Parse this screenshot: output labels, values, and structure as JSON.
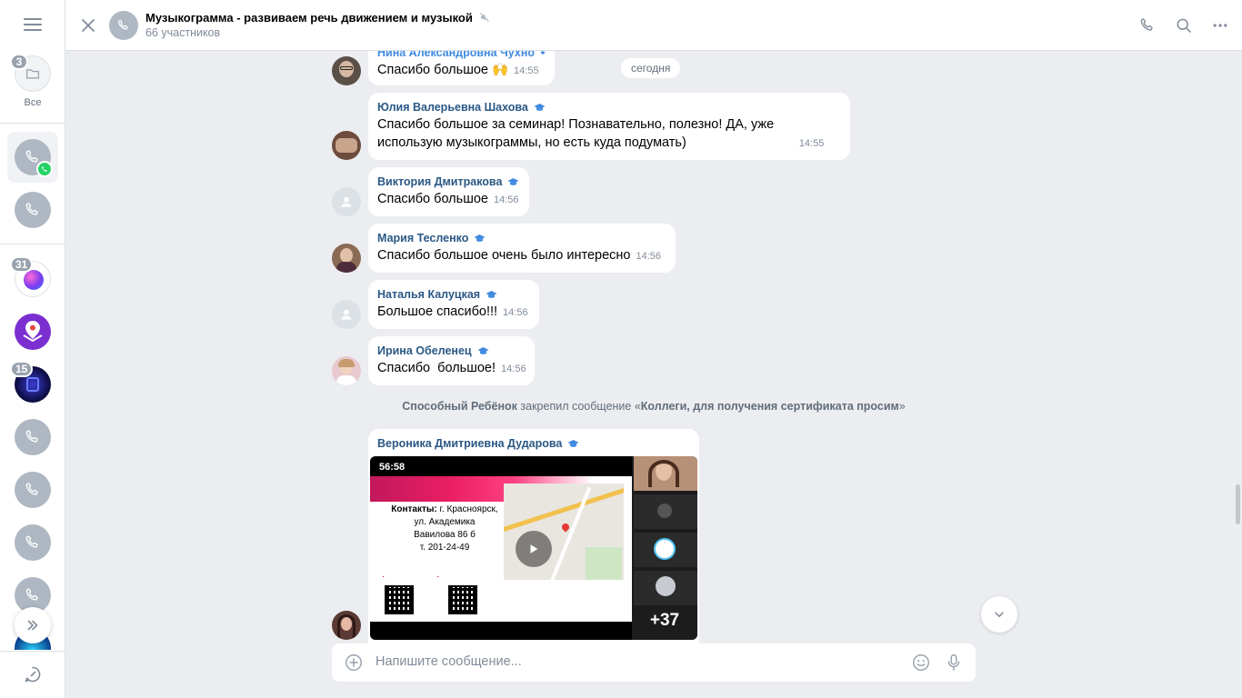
{
  "sidebar": {
    "folder_badge": "3",
    "folder_label": "Все",
    "badge_31": "31",
    "badge_15": "15"
  },
  "header": {
    "title": "Музыкограмма - развиваем речь движением и музыкой",
    "members": "66 участников"
  },
  "chat": {
    "date_chip": "сегодня",
    "messages": [
      {
        "author": "Нина Александровна Чухно",
        "text": "Спасибо большое 🙌",
        "time": "14:55"
      },
      {
        "author": "Юлия Валерьевна Шахова",
        "text": "Спасибо большое за семинар! Познавательно, полезно! ДА, уже",
        "text2": "использую музыкограммы, но есть куда подумать)",
        "time": "14:55"
      },
      {
        "author": "Виктория Дмитракова",
        "text": "Спасибо большое",
        "time": "14:56"
      },
      {
        "author": "Мария Тесленко",
        "text": "Спасибо большое очень было интересно",
        "time": "14:56"
      },
      {
        "author": "Наталья Калуцкая",
        "text": "Большое спасибо!!!",
        "time": "14:56"
      },
      {
        "author": "Ирина Обеленец",
        "text": "Спасибо  большое!",
        "time": "14:56"
      },
      {
        "author": "Вероника Дмитриевна Дударова"
      }
    ],
    "system": {
      "actor": "Способный Ребёнок",
      "action": " закрепил сообщение «",
      "pinned": "Коллеги, для получения сертификата просим",
      "close": "»"
    },
    "video": {
      "duration": "56:58",
      "contacts_label": "Контакты:",
      "contacts_lines": [
        " г. Красноярск,",
        "ул. Академика",
        "Вавилова 86 б",
        "т. 201-24-49"
      ],
      "participants_more": "+37"
    }
  },
  "composer": {
    "placeholder": "Напишите сообщение..."
  },
  "colors": {
    "accent": "#3f8ae0",
    "author": "#2a5885",
    "background": "#ebedf0",
    "whatsapp": "#25d366"
  }
}
